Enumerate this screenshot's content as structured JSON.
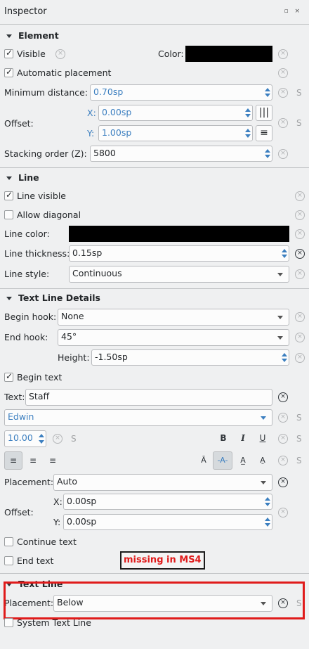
{
  "panel": {
    "title": "Inspector",
    "window_icons": "▫ ×"
  },
  "element": {
    "header": "Element",
    "visible": "Visible",
    "color_label": "Color:",
    "auto_placement": "Automatic placement",
    "min_distance_label": "Minimum distance:",
    "min_distance_value": "0.70sp",
    "offset_label": "Offset:",
    "x_label": "X:",
    "x_value": "0.00sp",
    "y_label": "Y:",
    "y_value": "1.00sp",
    "stacking_label": "Stacking order (Z):",
    "stacking_value": "5800"
  },
  "line": {
    "header": "Line",
    "line_visible": "Line visible",
    "allow_diagonal": "Allow diagonal",
    "color_label": "Line color:",
    "thickness_label": "Line thickness:",
    "thickness_value": "0.15sp",
    "style_label": "Line style:",
    "style_value": "Continuous"
  },
  "text_line_details": {
    "header": "Text Line Details",
    "begin_hook_label": "Begin hook:",
    "begin_hook_value": "None",
    "end_hook_label": "End hook:",
    "end_hook_value": "45°",
    "height_label": "Height:",
    "height_value": "-1.50sp",
    "begin_text": "Begin text",
    "text_label": "Text:",
    "text_value": "Staff",
    "font_value": "Edwin",
    "size_value": "10.00",
    "s": "S",
    "bold": "B",
    "italic": "I",
    "underline": "U",
    "placement_label": "Placement:",
    "placement_value": "Auto",
    "offset_label": "Offset:",
    "x_label": "X:",
    "x_value": "0.00sp",
    "y_label": "Y:",
    "y_value": "0.00sp",
    "continue_text": "Continue text",
    "end_text": "End text",
    "annotation": "missing in MS4"
  },
  "text_line": {
    "header": "Text Line",
    "placement_label": "Placement:",
    "placement_value": "Below",
    "system_text_line": "System Text Line"
  },
  "colors": {
    "accent": "#3c7fc0",
    "highlight": "#e01b1b",
    "background": "#eff0f1"
  }
}
